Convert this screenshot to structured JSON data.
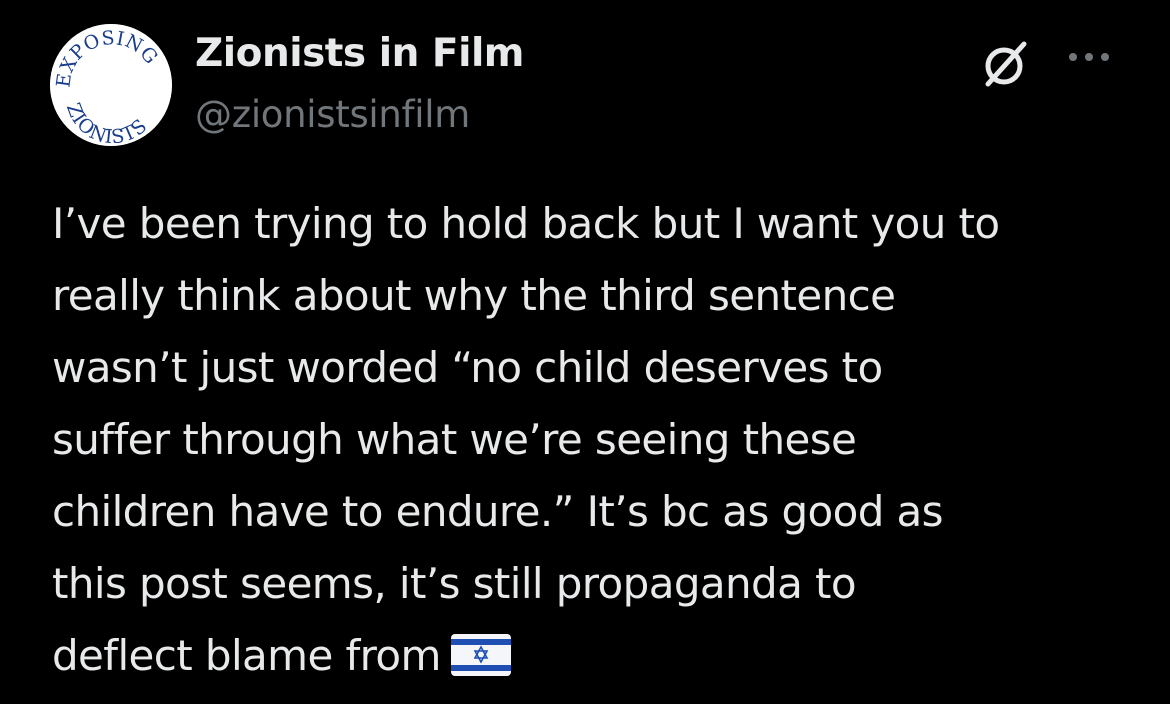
{
  "author": {
    "display_name": "Zionists in Film",
    "handle": "@zionistsinfilm",
    "avatar": {
      "top_text": "EXPOSING",
      "bottom_text": "ZIONISTS",
      "background": "#ffffff",
      "text_color": "#1a3e8c"
    }
  },
  "icons": {
    "grok": "grok-icon",
    "more": "more-options-icon",
    "flag": "israel-flag-emoji"
  },
  "tweet": {
    "lines": [
      "I’ve been trying to hold back but I want you to",
      "really think about why the third sentence",
      "wasn’t just worded “no child deserves to",
      "suffer through what we’re seeing these",
      "children have to endure.” It’s bc as good as",
      "this post seems, it’s still propaganda to",
      "deflect blame from"
    ]
  },
  "colors": {
    "background": "#000000",
    "primary_text": "#e7e9ea",
    "secondary_text": "#71767b",
    "flag_blue": "#1f4fb3"
  }
}
